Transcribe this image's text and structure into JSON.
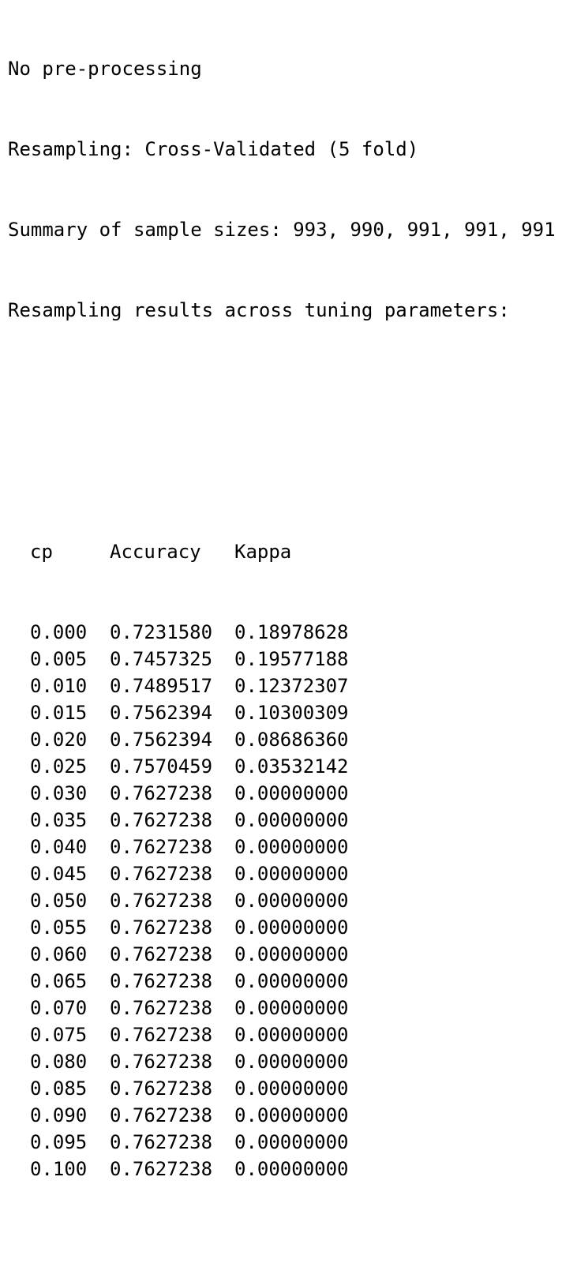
{
  "header_lines": [
    "No pre-processing",
    "Resampling: Cross-Validated (5 fold)",
    "Summary of sample sizes: 993, 990, 991, 991, 991",
    "Resampling results across tuning parameters:"
  ],
  "table": {
    "columns": [
      "cp",
      "Accuracy",
      "Kappa"
    ],
    "rows": [
      [
        "0.000",
        "0.7231580",
        "0.18978628"
      ],
      [
        "0.005",
        "0.7457325",
        "0.19577188"
      ],
      [
        "0.010",
        "0.7489517",
        "0.12372307"
      ],
      [
        "0.015",
        "0.7562394",
        "0.10300309"
      ],
      [
        "0.020",
        "0.7562394",
        "0.08686360"
      ],
      [
        "0.025",
        "0.7570459",
        "0.03532142"
      ],
      [
        "0.030",
        "0.7627238",
        "0.00000000"
      ],
      [
        "0.035",
        "0.7627238",
        "0.00000000"
      ],
      [
        "0.040",
        "0.7627238",
        "0.00000000"
      ],
      [
        "0.045",
        "0.7627238",
        "0.00000000"
      ],
      [
        "0.050",
        "0.7627238",
        "0.00000000"
      ],
      [
        "0.055",
        "0.7627238",
        "0.00000000"
      ],
      [
        "0.060",
        "0.7627238",
        "0.00000000"
      ],
      [
        "0.065",
        "0.7627238",
        "0.00000000"
      ],
      [
        "0.070",
        "0.7627238",
        "0.00000000"
      ],
      [
        "0.075",
        "0.7627238",
        "0.00000000"
      ],
      [
        "0.080",
        "0.7627238",
        "0.00000000"
      ],
      [
        "0.085",
        "0.7627238",
        "0.00000000"
      ],
      [
        "0.090",
        "0.7627238",
        "0.00000000"
      ],
      [
        "0.095",
        "0.7627238",
        "0.00000000"
      ],
      [
        "0.100",
        "0.7627238",
        "0.00000000"
      ]
    ]
  }
}
